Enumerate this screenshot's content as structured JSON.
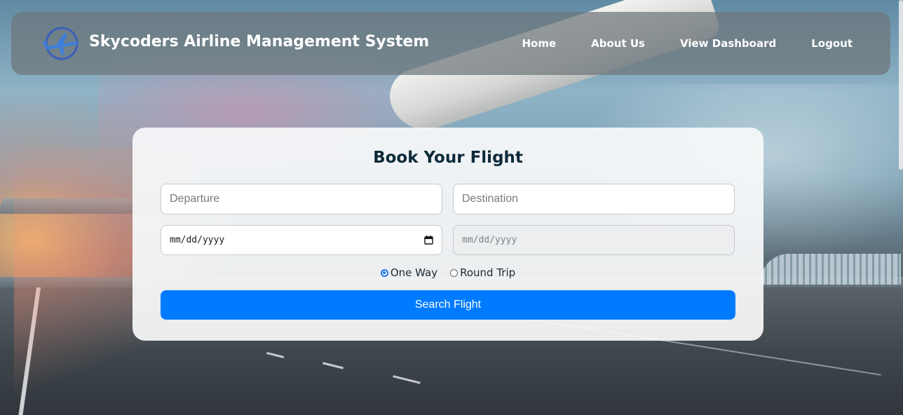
{
  "navbar": {
    "title": "Skycoders Airline Management System",
    "logo_icon": "airplane-logo-icon",
    "links": [
      "Home",
      "About Us",
      "View Dashboard",
      "Logout"
    ]
  },
  "booking": {
    "title": "Book Your Flight",
    "departure_placeholder": "Departure",
    "destination_placeholder": "Destination",
    "departure_date_placeholder": "mm/dd/yyyy",
    "return_date_placeholder": "mm/dd/yyyy",
    "trip_options": [
      "One Way",
      "Round Trip"
    ],
    "selected_trip": "One Way",
    "search_button": "Search Flight"
  },
  "colors": {
    "primary_button": "#007bff",
    "title_text": "#0d2a3a",
    "navbar_text": "#ffffff"
  }
}
